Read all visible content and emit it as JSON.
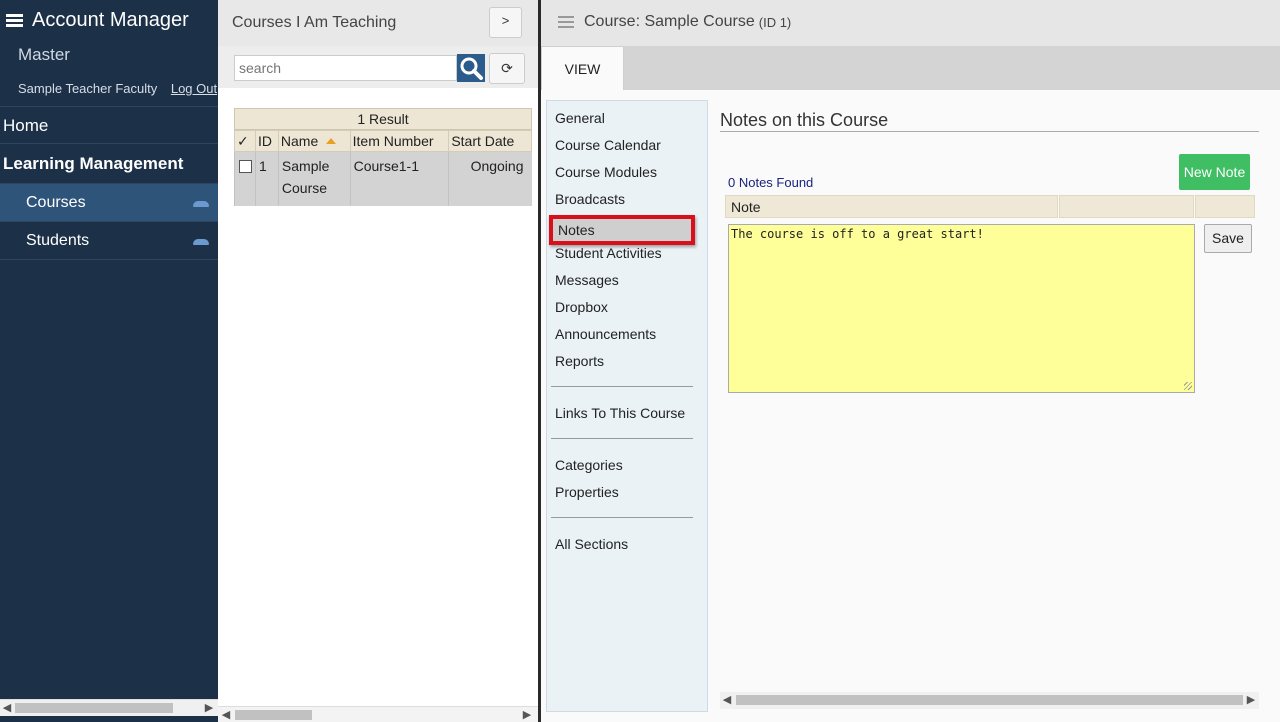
{
  "sidebar": {
    "app_title": "Account Manager",
    "org": "Master",
    "user": "Sample Teacher Faculty",
    "logout": "Log Out",
    "home": "Home",
    "section": "Learning Management",
    "items": [
      {
        "label": "Courses",
        "active": true
      },
      {
        "label": "Students",
        "active": false
      }
    ]
  },
  "list_panel": {
    "title": "Courses I Am Teaching",
    "expand_label": ">",
    "search_placeholder": "search",
    "refresh_symbol": "⟳",
    "result_count": "1 Result",
    "columns": [
      "✓",
      "ID",
      "Name",
      "Item Number",
      "Start Date"
    ],
    "rows": [
      {
        "id": "1",
        "name": "Sample Course",
        "item_number": "Course1-1",
        "start_date": "Ongoing"
      }
    ]
  },
  "detail": {
    "title": "Course: Sample Course",
    "id_suffix": "(ID 1)",
    "tab": "VIEW",
    "sections": [
      "General",
      "Course Calendar",
      "Course Modules",
      "Broadcasts",
      "Notes",
      "Student Activities",
      "Messages",
      "Dropbox",
      "Announcements",
      "Reports",
      "Links To This Course",
      "Categories",
      "Properties",
      "All Sections"
    ],
    "active_section": "Notes",
    "heading": "Notes on this Course",
    "new_note_label": "New Note",
    "notes_found": "0 Notes Found",
    "note_column": "Note",
    "note_text": "The course is off to a great start!",
    "save_label": "Save"
  },
  "colors": {
    "sidebar_bg": "#1c3048",
    "sidebar_active": "#2f5479",
    "accent_green": "#3fbe63",
    "highlight_red": "#d9101a",
    "note_yellow": "#ffff99"
  }
}
